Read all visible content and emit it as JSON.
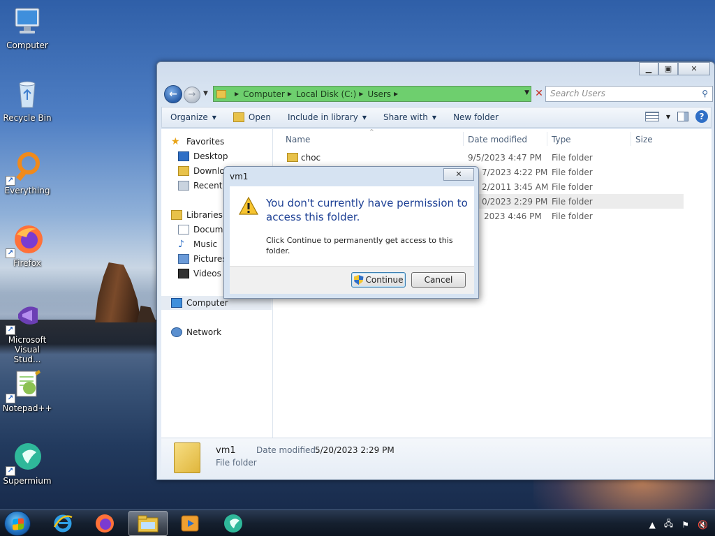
{
  "desktop": {
    "icons": [
      {
        "label": "Computer",
        "icon": "computer-icon"
      },
      {
        "label": "Recycle Bin",
        "icon": "recycle-bin-icon"
      },
      {
        "label": "Everything",
        "icon": "everything-search-icon"
      },
      {
        "label": "Firefox",
        "icon": "firefox-icon"
      },
      {
        "label": "Microsoft Visual Stud...",
        "icon": "visual-studio-icon"
      },
      {
        "label": "Notepad++",
        "icon": "notepad-plus-plus-icon"
      },
      {
        "label": "Supermium",
        "icon": "supermium-icon"
      }
    ]
  },
  "explorer": {
    "address": {
      "crumbs": [
        "Computer",
        "Local Disk (C:)",
        "Users"
      ]
    },
    "search_placeholder": "Search Users",
    "toolbar": {
      "organize": "Organize",
      "open": "Open",
      "include_in_library": "Include in library",
      "share_with": "Share with",
      "new_folder": "New folder"
    },
    "nav": {
      "favorites": "Favorites",
      "desktop": "Desktop",
      "downloads": "Downloads",
      "recent": "Recent Places",
      "libraries": "Libraries",
      "documents": "Documents",
      "music": "Music",
      "pictures": "Pictures",
      "videos": "Videos",
      "computer": "Computer",
      "network": "Network"
    },
    "columns": {
      "name": "Name",
      "date_modified": "Date modified",
      "type": "Type",
      "size": "Size"
    },
    "rows": [
      {
        "name": "choc",
        "date": "9/5/2023 4:47 PM",
        "type": "File folder"
      },
      {
        "name": "",
        "date": "7/2023 4:22 PM",
        "type": "File folder"
      },
      {
        "name": "",
        "date": "2/2011 3:45 AM",
        "type": "File folder"
      },
      {
        "name": "",
        "date": "0/2023 2:29 PM",
        "type": "File folder"
      },
      {
        "name": "",
        "date": "2023 4:46 PM",
        "type": "File folder"
      }
    ],
    "details": {
      "name": "vm1",
      "date_label": "Date modified:",
      "date_value": "5/20/2023 2:29 PM",
      "type": "File folder"
    }
  },
  "dialog": {
    "title": "vm1",
    "message": "You don't currently have permission to access this folder.",
    "detail": "Click Continue to permanently get access to this folder.",
    "continue_label": "Continue",
    "cancel_label": "Cancel"
  },
  "taskbar": {
    "apps": [
      "internet-explorer-icon",
      "firefox-icon",
      "file-explorer-icon",
      "media-player-icon",
      "supermium-icon"
    ]
  }
}
